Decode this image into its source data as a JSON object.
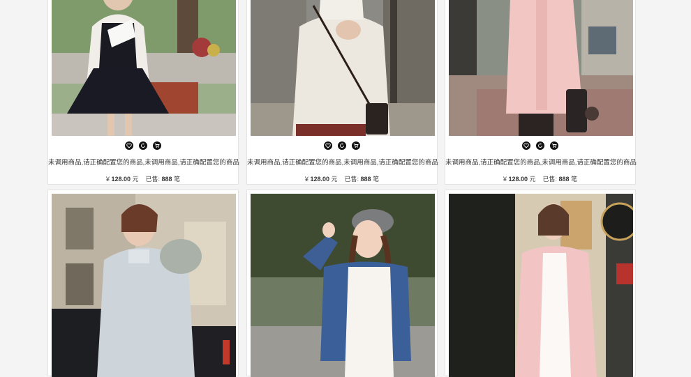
{
  "products": [
    {
      "title": "未调用商品,请正确配置您的商品,未调用商品,请正确配置您的商品",
      "currency": "¥",
      "price": "128.00",
      "price_unit": "元",
      "sold_label": "已售:",
      "sold_count": "888",
      "sold_unit": "笔"
    },
    {
      "title": "未调用商品,请正确配置您的商品,未调用商品,请正确配置您的商品",
      "currency": "¥",
      "price": "128.00",
      "price_unit": "元",
      "sold_label": "已售:",
      "sold_count": "888",
      "sold_unit": "笔"
    },
    {
      "title": "未调用商品,请正确配置您的商品,未调用商品,请正确配置您的商品",
      "currency": "¥",
      "price": "128.00",
      "price_unit": "元",
      "sold_label": "已售:",
      "sold_count": "888",
      "sold_unit": "笔"
    }
  ],
  "icons": [
    "heart-icon",
    "refresh-icon",
    "cart-icon"
  ]
}
